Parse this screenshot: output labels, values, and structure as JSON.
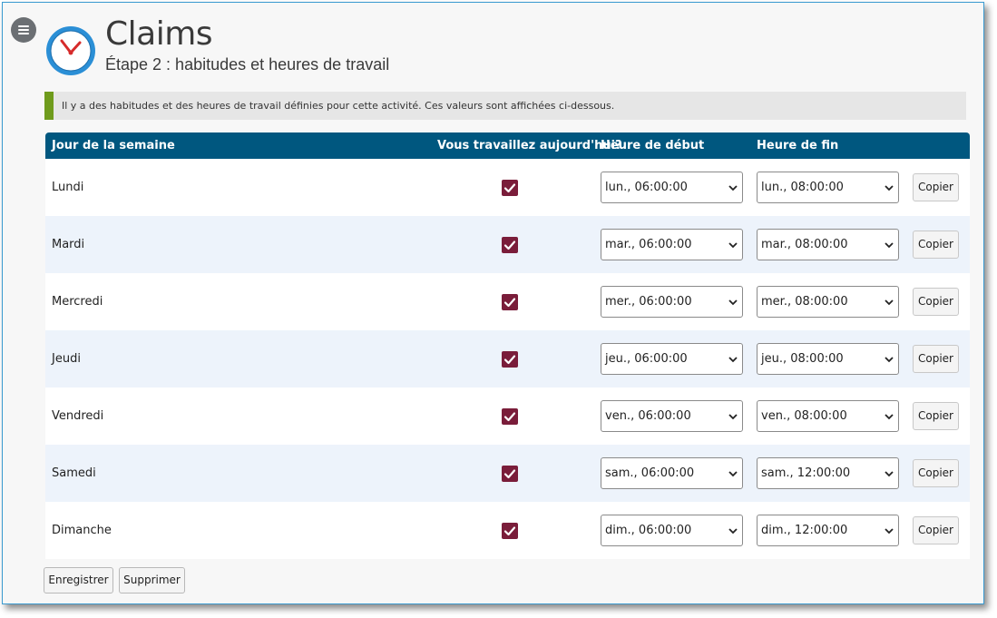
{
  "header": {
    "title": "Claims",
    "subtitle": "Étape 2 : habitudes et heures de travail"
  },
  "info_message": "Il y a des habitudes et des heures de travail définies pour cette activité. Ces valeurs sont affichées ci-dessous.",
  "table": {
    "columns": [
      "Jour de la semaine",
      "Vous travaillez aujourd'hui?",
      "Heure de début",
      "Heure de fin"
    ],
    "rows": [
      {
        "day": "Lundi",
        "works": true,
        "start": "lun., 06:00:00",
        "end": "lun., 08:00:00",
        "copy": "Copier"
      },
      {
        "day": "Mardi",
        "works": true,
        "start": "mar., 06:00:00",
        "end": "mar., 08:00:00",
        "copy": "Copier"
      },
      {
        "day": "Mercredi",
        "works": true,
        "start": "mer., 06:00:00",
        "end": "mer., 08:00:00",
        "copy": "Copier"
      },
      {
        "day": "Jeudi",
        "works": true,
        "start": "jeu., 06:00:00",
        "end": "jeu., 08:00:00",
        "copy": "Copier"
      },
      {
        "day": "Vendredi",
        "works": true,
        "start": "ven., 06:00:00",
        "end": "ven., 08:00:00",
        "copy": "Copier"
      },
      {
        "day": "Samedi",
        "works": true,
        "start": "sam., 06:00:00",
        "end": "sam., 12:00:00",
        "copy": "Copier"
      },
      {
        "day": "Dimanche",
        "works": true,
        "start": "dim., 06:00:00",
        "end": "dim., 12:00:00",
        "copy": "Copier"
      }
    ]
  },
  "actions": {
    "save_label": "Enregistrer",
    "delete_label": "Supprimer"
  },
  "icons": {
    "menu": "hamburger-menu-icon",
    "app": "clock-icon",
    "checkbox": "checkmark-icon",
    "dropdown": "chevron-down-icon"
  },
  "colors": {
    "header_bg": "#00577f",
    "checkbox": "#7a1d3a",
    "info_accent": "#6f9b1c",
    "row_alt": "#edf3fb",
    "frame_border": "#3a9ad0"
  }
}
